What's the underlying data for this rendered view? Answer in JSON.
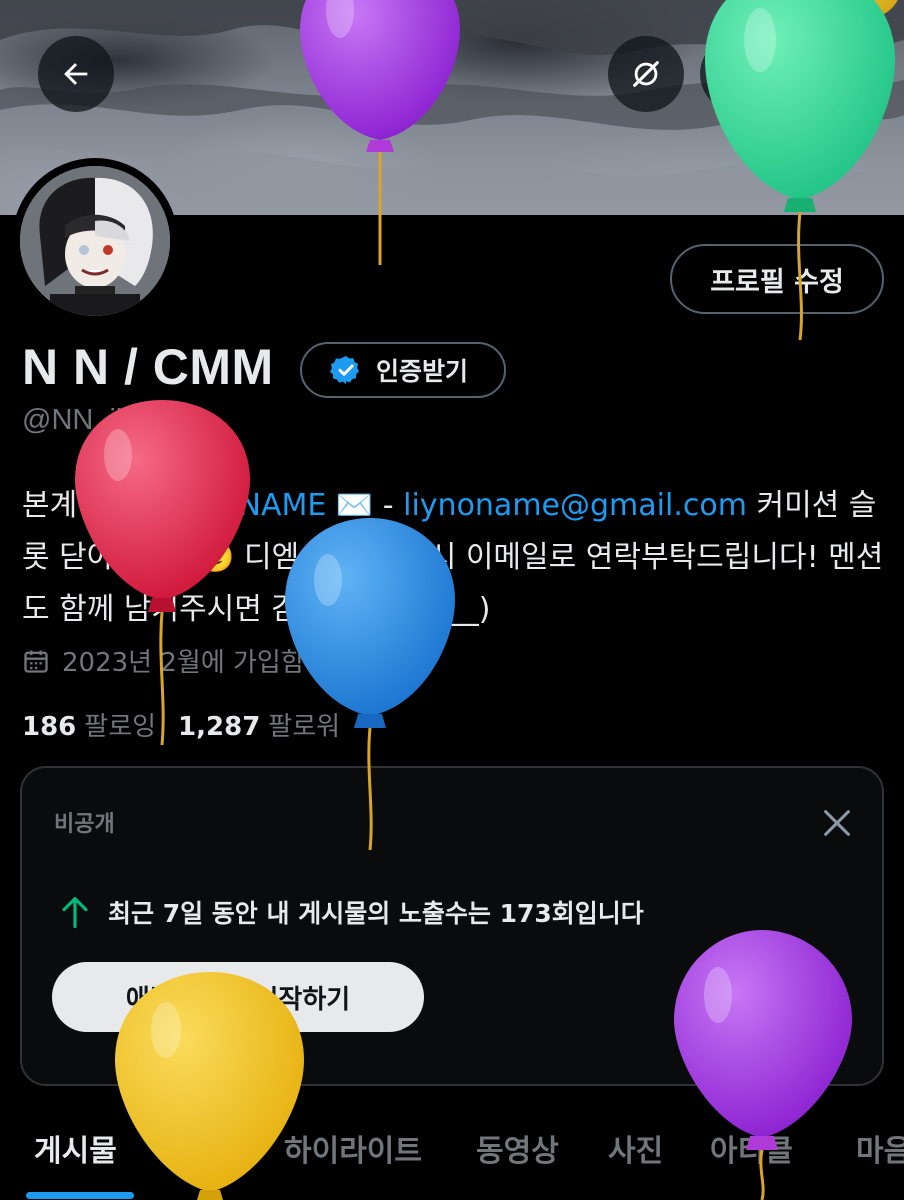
{
  "header": {
    "back_icon": "arrow-left-icon",
    "grok_icon": "grok-icon",
    "search_icon": "search-icon",
    "share_icon": "share-icon"
  },
  "profile": {
    "edit_label": "프로필 수정",
    "name": "N N / CMM",
    "verify_label": "인증받기",
    "handle": "@NN_iiii",
    "bio": {
      "prefix": "본계 - ",
      "mention": "@NN_N0NAME",
      "mid": " ✉️ - ",
      "email": "liynoname@gmail.com",
      "suffix": " 커미션 슬롯 닫아둡니다🥲 디엠 막혀있을 시 이메일로 연락부탁드립니다! 멘션도 함께 남겨주시면 감사드립니다(__)"
    },
    "joined": "2023년 2월에 가입함",
    "following_count": "186",
    "following_label": "팔로잉",
    "followers_count": "1,287",
    "followers_label": "팔로워"
  },
  "analytics_card": {
    "title": "비공개",
    "stat_text": "최근 7일 동안 내 게시물의 노출수는 173회입니다",
    "button_label": "애널리틱스 시작하기"
  },
  "tabs": [
    {
      "label": "게시물",
      "active": true
    },
    {
      "label": "답글",
      "active": false
    },
    {
      "label": "하이라이트",
      "active": false
    },
    {
      "label": "동영상",
      "active": false
    },
    {
      "label": "사진",
      "active": false
    },
    {
      "label": "아티클",
      "active": false
    },
    {
      "label": "마음",
      "active": false
    }
  ],
  "colors": {
    "accent": "#1d9bf0",
    "verified": "#1d9bf0",
    "stat_arrow": "#00ba7c",
    "balloons": [
      "#9b30e0",
      "#2fd98f",
      "#e0284a",
      "#2b8ee6",
      "#f2c21b",
      "#9a2fd8"
    ]
  }
}
